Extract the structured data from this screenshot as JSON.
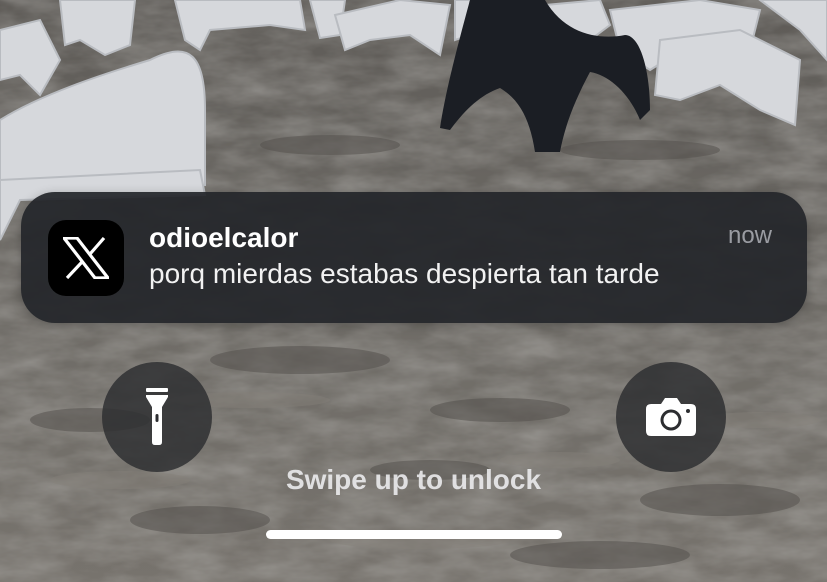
{
  "notification": {
    "app_icon": "x-logo-icon",
    "title": "odioelcalor",
    "time": "now",
    "body": "porq mierdas estabas despierta tan tarde"
  },
  "lock_screen": {
    "flashlight_icon": "flashlight-icon",
    "camera_icon": "camera-icon",
    "unlock_hint": "Swipe up to unlock"
  },
  "wallpaper": {
    "description_icon": "beach-photo",
    "sand_color": "#6d6a66",
    "chair_color": "#d6d8dc",
    "dark_chair_color": "#1b1e24"
  },
  "colors": {
    "notification_bg": "#24262a",
    "button_bg": "#2c2d30",
    "text_primary": "#ffffff",
    "text_secondary": "#9a9ca2"
  }
}
